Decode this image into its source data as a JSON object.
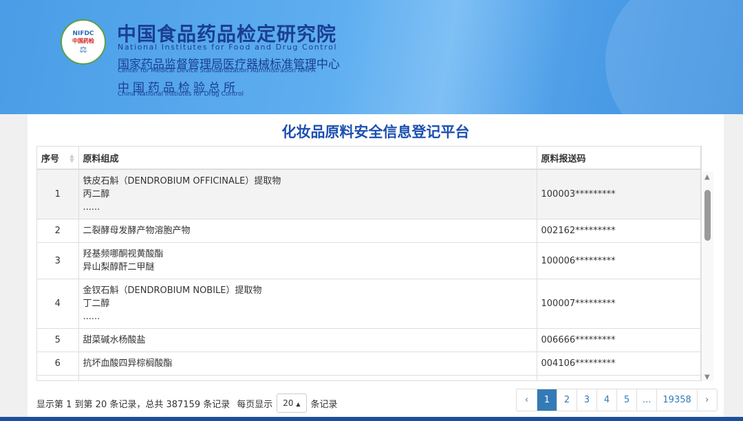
{
  "header": {
    "logo_text": "NIFDC",
    "logo_sub": "中国药检",
    "title_cn": "中国食品药品检定研究院",
    "title_en": "National Institutes for Food and Drug Control",
    "sub1_cn": "国家药品监督管理局医疗器械标准管理中心",
    "sub1_en": "Center for Medical Device Standardization Administration NMPA",
    "sub2_cn": "中国药品检验总所",
    "sub2_en": "China National Instiutes for Drug Control"
  },
  "page_title": "化妆品原料安全信息登记平台",
  "table": {
    "columns": [
      "序号",
      "原料组成",
      "原料报送码"
    ],
    "rows": [
      {
        "no": "1",
        "lines": [
          "铁皮石斛（DENDROBIUM OFFICINALE）提取物",
          "丙二醇",
          "......"
        ],
        "code": "100003*********"
      },
      {
        "no": "2",
        "lines": [
          "二裂酵母发酵产物溶胞产物"
        ],
        "code": "002162*********"
      },
      {
        "no": "3",
        "lines": [
          "羟基频哪酮视黄酸酯",
          "异山梨醇酐二甲醚"
        ],
        "code": "100006*********"
      },
      {
        "no": "4",
        "lines": [
          "金钗石斛（DENDROBIUM NOBILE）提取物",
          "丁二醇",
          "......"
        ],
        "code": "100007*********"
      },
      {
        "no": "5",
        "lines": [
          "甜菜碱水杨酸盐"
        ],
        "code": "006666*********"
      },
      {
        "no": "6",
        "lines": [
          "抗坏血酸四异棕榈酸酯"
        ],
        "code": "004106*********"
      }
    ]
  },
  "footer": {
    "info": "显示第 1 到第 20 条记录，总共 387159 条记录",
    "per_page_label": "每页显示",
    "per_page": "20",
    "per_page_suffix": "条记录"
  },
  "pagination": {
    "prev": "‹",
    "pages": [
      "1",
      "2",
      "3",
      "4",
      "5",
      "...",
      "19358"
    ],
    "next": "›",
    "active": "1"
  }
}
